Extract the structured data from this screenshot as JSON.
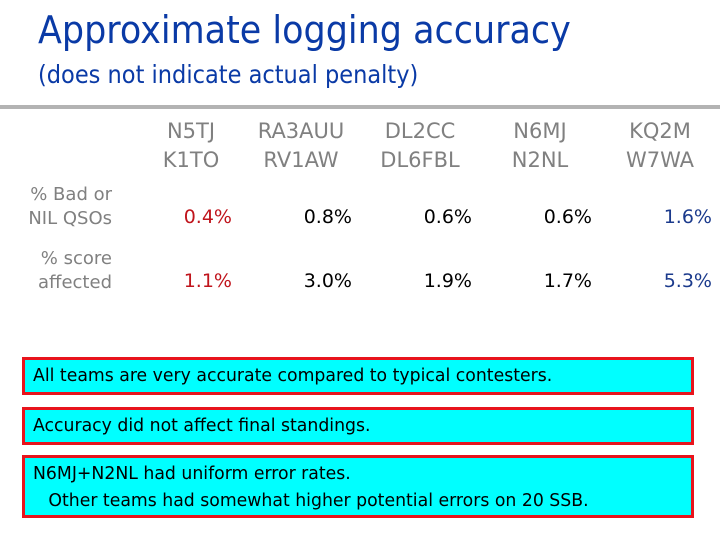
{
  "header": {
    "title": "Approximate logging accuracy",
    "subtitle": "(does not indicate actual penalty)"
  },
  "table": {
    "columns": [
      {
        "line1": "N5TJ",
        "line2": "K1TO"
      },
      {
        "line1": "RA3AUU",
        "line2": "RV1AW"
      },
      {
        "line1": "DL2CC",
        "line2": "DL6FBL"
      },
      {
        "line1": "N6MJ",
        "line2": "N2NL"
      },
      {
        "line1": "KQ2M",
        "line2": "W7WA"
      }
    ],
    "rows": [
      {
        "label_line1": "% Bad or",
        "label_line2": "NIL QSOs",
        "values": [
          "0.4%",
          "0.8%",
          "0.6%",
          "0.6%",
          "1.6%"
        ]
      },
      {
        "label_line1": "% score",
        "label_line2": "affected",
        "values": [
          "1.1%",
          "3.0%",
          "1.9%",
          "1.7%",
          "5.3%"
        ]
      }
    ],
    "colors": {
      "lowest": "#c0141c",
      "normal": "#000000",
      "highest": "#1b3a8c"
    }
  },
  "notes": [
    {
      "lines": [
        "All teams are very accurate compared to typical contesters."
      ]
    },
    {
      "lines": [
        "Accuracy did not affect final standings."
      ]
    },
    {
      "lines": [
        "N6MJ+N2NL had uniform error rates.",
        "Other teams had somewhat higher potential errors on 20 SSB."
      ]
    }
  ],
  "style_colors": {
    "title": "#0a3aa6",
    "box_fill": "#00ffff",
    "box_border": "#e8141c",
    "divider": "#b3b3b3"
  }
}
